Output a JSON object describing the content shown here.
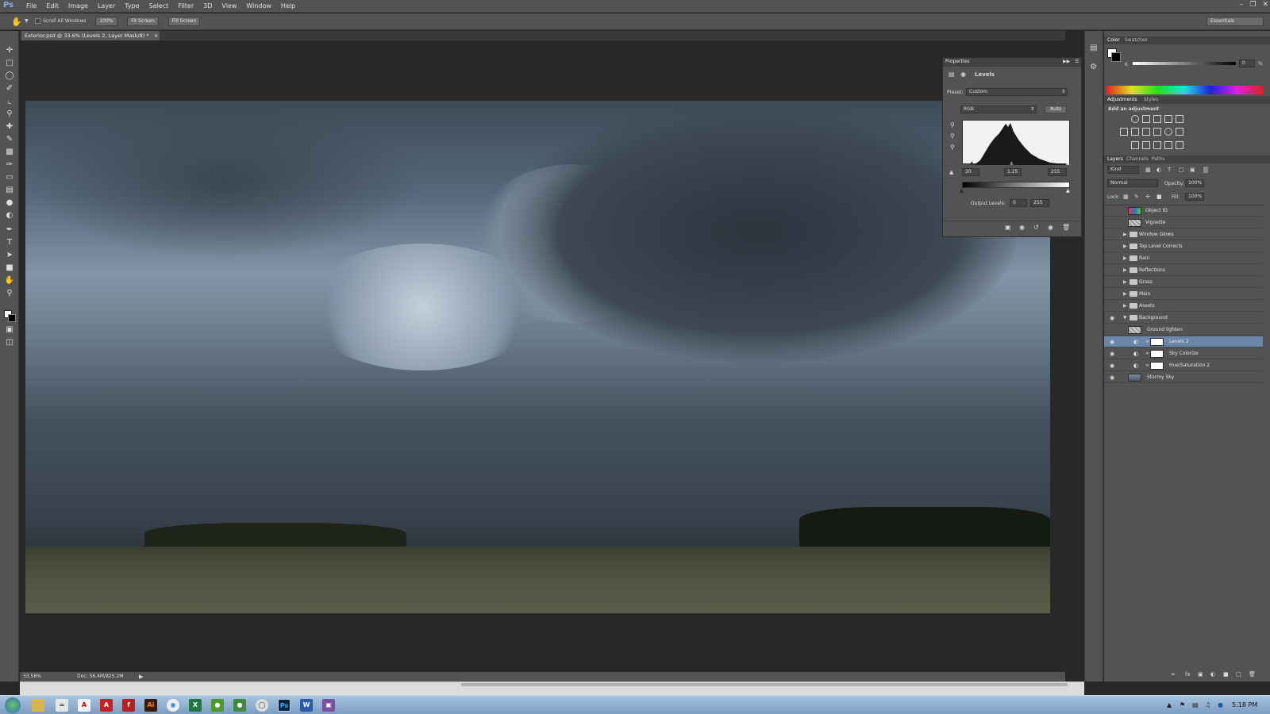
{
  "app": {
    "logo": "Ps",
    "workspace": "Essentials"
  },
  "menu": [
    "File",
    "Edit",
    "Image",
    "Layer",
    "Type",
    "Select",
    "Filter",
    "3D",
    "View",
    "Window",
    "Help"
  ],
  "options": {
    "scroll_all": "Scroll All Windows",
    "zoom": "100%",
    "fit": "Fit Screen",
    "fill": "Fill Screen"
  },
  "document": {
    "tab_title": "Exterior.psd @ 33.6% (Levels 2, Layer Mask/8) *",
    "close": "×"
  },
  "status": {
    "zoom": "33.58%",
    "doc": "Doc: 56.4M/825.2M"
  },
  "properties": {
    "tab": "Properties",
    "title": "Levels",
    "preset_label": "Preset:",
    "preset_value": "Custom",
    "channel": "RGB",
    "auto": "Auto",
    "input_black": "20",
    "input_gamma": "1.25",
    "input_white": "255",
    "output_label": "Output Levels:",
    "output_black": "0",
    "output_white": "255"
  },
  "color_panel": {
    "tabs": [
      "Color",
      "Swatches"
    ],
    "channel": "K",
    "value": "0",
    "unit": "%"
  },
  "adjustments": {
    "tabs": [
      "Adjustments",
      "Styles"
    ],
    "heading": "Add an adjustment"
  },
  "layers_panel": {
    "tabs": [
      "Layers",
      "Channels",
      "Paths"
    ],
    "kind": "Kind",
    "blend": "Normal",
    "opacity_label": "Opacity:",
    "opacity": "100%",
    "lock_label": "Lock:",
    "fill_label": "Fill:",
    "fill": "100%",
    "layers": [
      {
        "name": "Object ID",
        "type": "layer",
        "visible": false
      },
      {
        "name": "Vignette",
        "type": "layer",
        "visible": false
      },
      {
        "name": "Window Glows",
        "type": "group",
        "visible": false
      },
      {
        "name": "Top Level Corrects",
        "type": "group",
        "visible": false
      },
      {
        "name": "Rain",
        "type": "group",
        "visible": false
      },
      {
        "name": "Reflections",
        "type": "group",
        "visible": false
      },
      {
        "name": "Grass",
        "type": "group",
        "visible": false
      },
      {
        "name": "Main",
        "type": "group",
        "visible": false
      },
      {
        "name": "Assets",
        "type": "group",
        "visible": false
      },
      {
        "name": "Background",
        "type": "group-open",
        "visible": true
      },
      {
        "name": "Ground lighten",
        "type": "layer",
        "visible": false
      },
      {
        "name": "Levels 2",
        "type": "adjustment",
        "visible": true,
        "selected": true
      },
      {
        "name": "Sky Colorize",
        "type": "adjustment",
        "visible": true
      },
      {
        "name": "Hue/Saturation 2",
        "type": "adjustment",
        "visible": true
      },
      {
        "name": "Stormy Sky",
        "type": "layer",
        "visible": true
      }
    ]
  },
  "taskbar": {
    "time": "5:18 PM"
  },
  "icons": {
    "eye": "eye-icon",
    "folder": "folder-icon",
    "hand": "hand-tool-icon",
    "zoom": "zoom-tool-icon"
  },
  "colors": {
    "accent_selection": "#6b86a9",
    "panel": "#535353",
    "canvas_bg": "#282828"
  }
}
